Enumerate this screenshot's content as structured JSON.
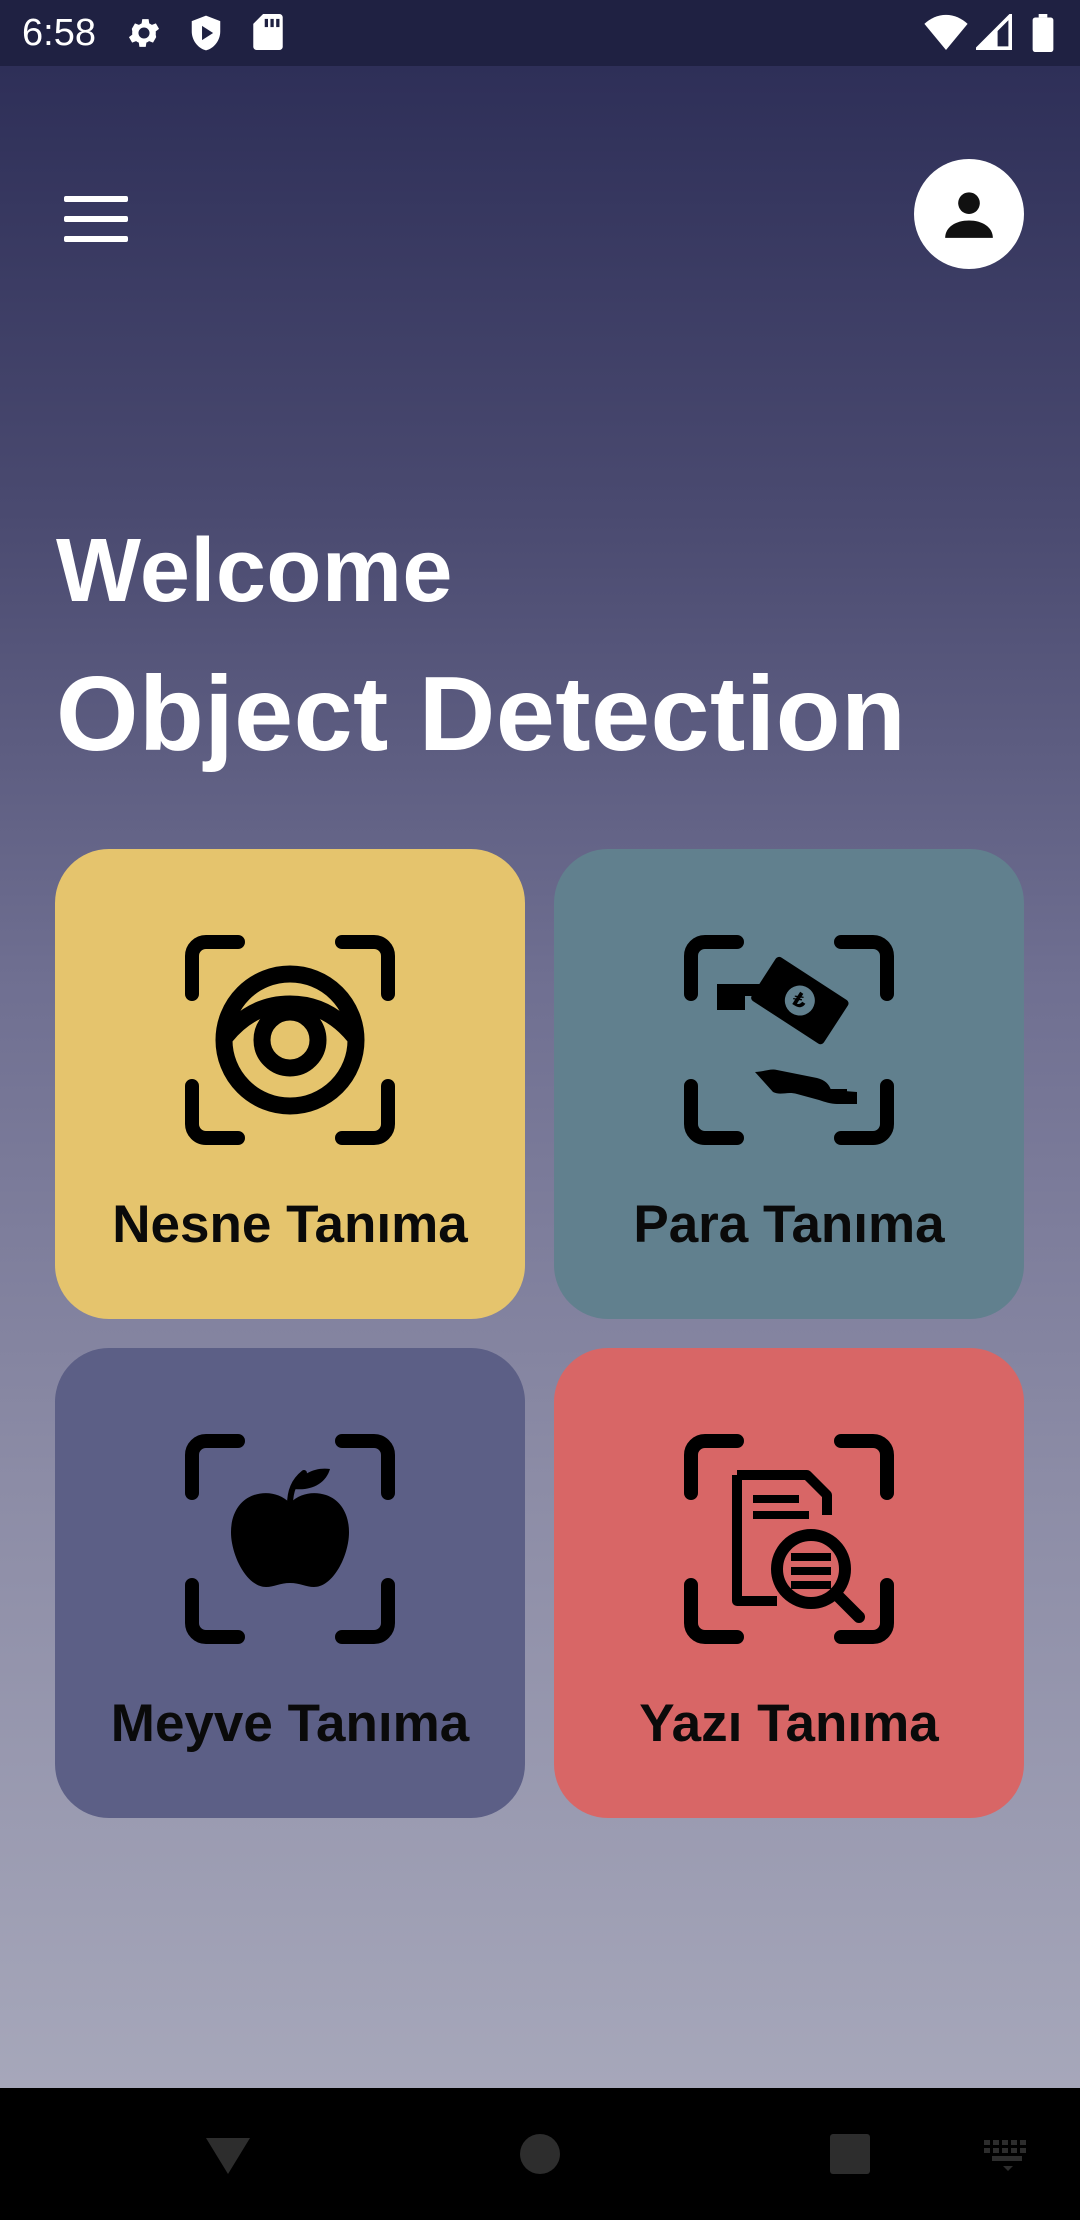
{
  "status_bar": {
    "time": "6:58",
    "left_icons": [
      "settings-icon",
      "shield-play-icon",
      "sd-card-icon"
    ],
    "right_icons": [
      "wifi-icon",
      "signal-icon",
      "battery-icon"
    ]
  },
  "header": {
    "menu_icon": "hamburger-menu-icon",
    "profile_icon": "account-icon"
  },
  "greeting": {
    "welcome": "Welcome",
    "title": "Object Detection"
  },
  "cards": [
    {
      "label": "Nesne Tanıma",
      "icon": "eye-scan-icon",
      "color": "#e5c46d"
    },
    {
      "label": "Para Tanıma",
      "icon": "money-scan-icon",
      "color": "#61808e"
    },
    {
      "label": "Meyve Tanıma",
      "icon": "apple-scan-icon",
      "color": "#5c5f86"
    },
    {
      "label": "Yazı Tanıma",
      "icon": "document-search-scan-icon",
      "color": "#d86666"
    }
  ],
  "nav_bar": {
    "buttons": [
      "back-icon",
      "home-icon",
      "recents-icon",
      "keyboard-icon"
    ]
  }
}
